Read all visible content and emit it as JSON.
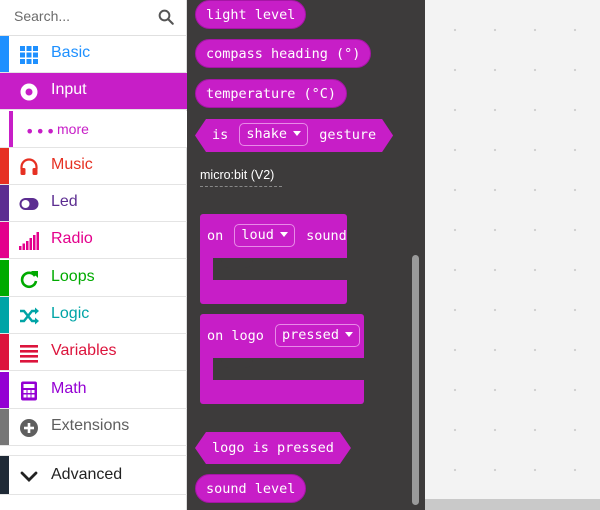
{
  "search": {
    "placeholder": "Search..."
  },
  "categories": [
    {
      "label": "Basic",
      "color": "#1e90ff",
      "icon": "grid-icon"
    },
    {
      "label": "Input",
      "color": "#c71ec7",
      "icon": "radio-button-icon",
      "selected": true
    },
    {
      "label": "Music",
      "color": "#e63022",
      "icon": "headphones-icon"
    },
    {
      "label": "Led",
      "color": "#5c2d91",
      "icon": "toggle-icon"
    },
    {
      "label": "Radio",
      "color": "#e3008c",
      "icon": "signal-bars-icon"
    },
    {
      "label": "Loops",
      "color": "#00aa00",
      "icon": "refresh-icon"
    },
    {
      "label": "Logic",
      "color": "#00a4a6",
      "icon": "shuffle-icon"
    },
    {
      "label": "Variables",
      "color": "#dc143c",
      "icon": "list-icon"
    },
    {
      "label": "Math",
      "color": "#9400d3",
      "icon": "calculator-icon"
    },
    {
      "label": "Extensions",
      "color": "#777777",
      "icon": "plus-circle-icon"
    },
    {
      "label": "Advanced",
      "color": "#3c3c3c",
      "icon": "chevron-down-icon"
    }
  ],
  "more": {
    "label": "more",
    "dots": "•••"
  },
  "flyout": {
    "light_level": "light level",
    "compass_heading": "compass heading (°)",
    "temperature": "temperature (°C)",
    "is": "is",
    "shake": "shake",
    "gesture": "gesture",
    "section_label": "micro:bit (V2)",
    "on": "on",
    "loud": "loud",
    "sound": "sound",
    "on_logo": "on logo",
    "pressed": "pressed",
    "logo_is_pressed": "logo is pressed",
    "sound_level": "sound level"
  }
}
